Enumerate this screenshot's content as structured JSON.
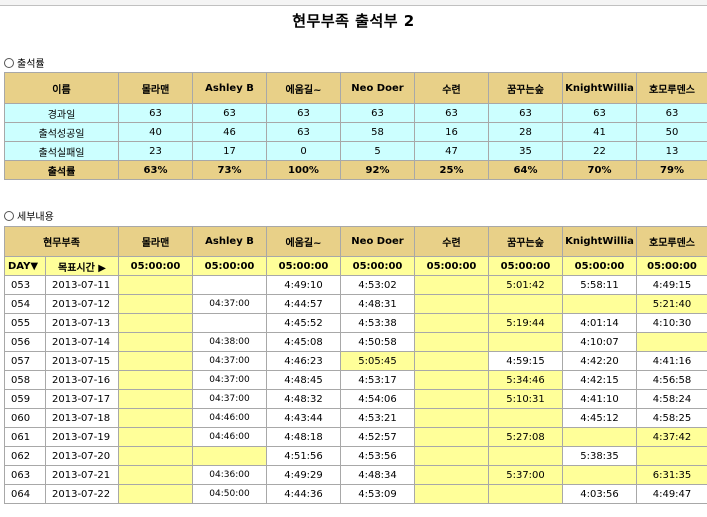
{
  "title": "현무부족 출석부 2",
  "summary": {
    "section_label": "출석률",
    "name_header": "이름",
    "names": [
      "몰라맨",
      "Ashley B",
      "에움길~",
      "Neo Doer",
      "수련",
      "꿈꾸는숲",
      "KnightWillia",
      "호모루덴스"
    ],
    "rows": [
      {
        "label": "경과일",
        "values": [
          "63",
          "63",
          "63",
          "63",
          "63",
          "63",
          "63",
          "63"
        ]
      },
      {
        "label": "출석성공일",
        "values": [
          "40",
          "46",
          "63",
          "58",
          "16",
          "28",
          "41",
          "50"
        ]
      },
      {
        "label": "출석실패일",
        "values": [
          "23",
          "17",
          "0",
          "5",
          "47",
          "35",
          "22",
          "13"
        ]
      }
    ],
    "rate": {
      "label": "출석률",
      "values": [
        "63%",
        "73%",
        "100%",
        "92%",
        "25%",
        "64%",
        "70%",
        "79%"
      ]
    }
  },
  "detail": {
    "section_label": "세부내용",
    "tribe_header": "현무부족",
    "names": [
      "몰라맨",
      "Ashley B",
      "에움길~",
      "Neo Doer",
      "수련",
      "꿈꾸는숲",
      "KnightWillia",
      "호모루덴스"
    ],
    "day_header": "DAY▼",
    "target_header": "목표시간 ▶",
    "targets": [
      "05:00:00",
      "05:00:00",
      "05:00:00",
      "05:00:00",
      "05:00:00",
      "05:00:00",
      "05:00:00",
      "05:00:00"
    ],
    "rows": [
      {
        "day": "053",
        "date": "2013-07-11",
        "times": [
          "",
          "",
          "4:49:10",
          "4:53:02",
          "",
          "5:01:42",
          "5:58:11",
          "4:49:15"
        ]
      },
      {
        "day": "054",
        "date": "2013-07-12",
        "times": [
          "",
          "04:37:00",
          "4:44:57",
          "4:48:31",
          "",
          "",
          "",
          "5:21:40"
        ]
      },
      {
        "day": "055",
        "date": "2013-07-13",
        "times": [
          "",
          "",
          "4:45:52",
          "4:53:38",
          "",
          "5:19:44",
          "4:01:14",
          "4:10:30"
        ]
      },
      {
        "day": "056",
        "date": "2013-07-14",
        "times": [
          "",
          "04:38:00",
          "4:45:08",
          "4:50:58",
          "",
          "",
          "4:10:07",
          ""
        ]
      },
      {
        "day": "057",
        "date": "2013-07-15",
        "times": [
          "",
          "04:37:00",
          "4:46:23",
          "5:05:45",
          "",
          "4:59:15",
          "4:42:20",
          "4:41:16"
        ]
      },
      {
        "day": "058",
        "date": "2013-07-16",
        "times": [
          "",
          "04:37:00",
          "4:48:45",
          "4:53:17",
          "",
          "5:34:46",
          "4:42:15",
          "4:56:58"
        ]
      },
      {
        "day": "059",
        "date": "2013-07-17",
        "times": [
          "",
          "04:37:00",
          "4:48:32",
          "4:54:06",
          "",
          "5:10:31",
          "4:41:10",
          "4:58:24"
        ]
      },
      {
        "day": "060",
        "date": "2013-07-18",
        "times": [
          "",
          "04:46:00",
          "4:43:44",
          "4:53:21",
          "",
          "",
          "4:45:12",
          "4:58:25"
        ]
      },
      {
        "day": "061",
        "date": "2013-07-19",
        "times": [
          "",
          "04:46:00",
          "4:48:18",
          "4:52:57",
          "",
          "5:27:08",
          "",
          "4:37:42"
        ]
      },
      {
        "day": "062",
        "date": "2013-07-20",
        "times": [
          "",
          "",
          "4:51:56",
          "4:53:56",
          "",
          "",
          "5:38:35",
          ""
        ]
      },
      {
        "day": "063",
        "date": "2013-07-21",
        "times": [
          "",
          "04:36:00",
          "4:49:29",
          "4:48:34",
          "",
          "5:37:00",
          "",
          "6:31:35"
        ]
      },
      {
        "day": "064",
        "date": "2013-07-22",
        "times": [
          "",
          "04:50:00",
          "4:44:36",
          "4:53:09",
          "",
          "",
          "4:03:56",
          "4:49:47"
        ]
      }
    ],
    "cell_fill": [
      [
        "y",
        "w",
        "w",
        "w",
        "y",
        "y",
        "w",
        "w"
      ],
      [
        "y",
        "w",
        "w",
        "w",
        "y",
        "y",
        "y",
        "y"
      ],
      [
        "y",
        "w",
        "w",
        "w",
        "y",
        "y",
        "w",
        "w"
      ],
      [
        "y",
        "w",
        "w",
        "w",
        "y",
        "y",
        "w",
        "y"
      ],
      [
        "y",
        "w",
        "w",
        "y",
        "y",
        "w",
        "w",
        "w"
      ],
      [
        "y",
        "w",
        "w",
        "w",
        "y",
        "y",
        "w",
        "w"
      ],
      [
        "y",
        "w",
        "w",
        "w",
        "y",
        "y",
        "w",
        "w"
      ],
      [
        "y",
        "w",
        "w",
        "w",
        "y",
        "y",
        "w",
        "w"
      ],
      [
        "y",
        "w",
        "w",
        "w",
        "y",
        "y",
        "y",
        "y"
      ],
      [
        "y",
        "y",
        "w",
        "w",
        "y",
        "y",
        "w",
        "y"
      ],
      [
        "y",
        "w",
        "w",
        "w",
        "y",
        "y",
        "y",
        "y"
      ],
      [
        "y",
        "w",
        "w",
        "w",
        "y",
        "y",
        "w",
        "w"
      ]
    ]
  },
  "colors": {
    "header_gold": "#e8d088",
    "light_cyan": "#ccffff",
    "yellow_cell": "#ffff99",
    "grid_border": "#a8a8a8"
  }
}
